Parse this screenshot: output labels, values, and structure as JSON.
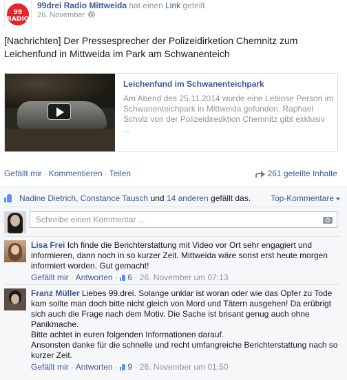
{
  "colors": {
    "link": "#3b5998",
    "muted": "#90949c",
    "brand_red": "#e3262c"
  },
  "post": {
    "avatar_logo": "99 RADIO",
    "page_name": "99drei Radio Mittweida",
    "shared_pre": "hat einen",
    "shared_link": "Link",
    "shared_post": "geteilt.",
    "date": "26. November",
    "text": "[Nachrichten] Der Pressesprecher der Polizeidirketion Chemnitz zum Leichenfund in Mittweida im Park am Schwanenteich",
    "preview": {
      "title": "Leichenfund im Schwanenteichpark",
      "description": "Am Abend des 25.11.2014 wurde eine Leblose Person im Schwanenteichpark in Mittweida gefunden. Raphael Scholz von der Polizeidiredktion Chemnitz gibt exklusiv ..."
    }
  },
  "actions": {
    "like": "Gefällt mir",
    "comment": "Kommentieren",
    "share": "Teilen",
    "shares_count": "261 geteilte Inhalte"
  },
  "likes": {
    "names": "Nadine Dietrich, Constance Tausch",
    "and": "und",
    "others": "14 anderen",
    "suffix": "gefällt das.",
    "top_comments": "Top-Kommentare"
  },
  "comment_box": {
    "placeholder": "Schreibe einen Kommentar ..."
  },
  "comments": [
    {
      "author": "Lisa Frei",
      "text": "Ich finde die Berichterstattung mit Video vor Ort sehr engagiert und informieren, dann noch in so kurzer Zeit. Mittweida wäre sonst erst heute morgen informiert worden. Gut gemacht!",
      "like": "Gefällt mir",
      "reply": "Antworten",
      "likes": "6",
      "time": "26. November um 07:13"
    },
    {
      "author": "Franz Müller",
      "text": "Liebes 99.drei. Solange unklar ist woran oder wie das Opfer zu Tode kam sollte man doch bitte nicht gleich von Mord und Tätern ausgehen! Da erübrigt sich auch die Frage nach dem Motiv. Die Sache ist brisant genug auch ohne Panikmache.\nBitte achtet in euren folgenden Informationen darauf.\nAnsonsten danke für die schnelle und recht umfangreiche Berichterstattung nach so kurzer Zeit.",
      "like": "Gefällt mir",
      "reply": "Antworten",
      "likes": "9",
      "time": "26. November um 01:50"
    }
  ]
}
